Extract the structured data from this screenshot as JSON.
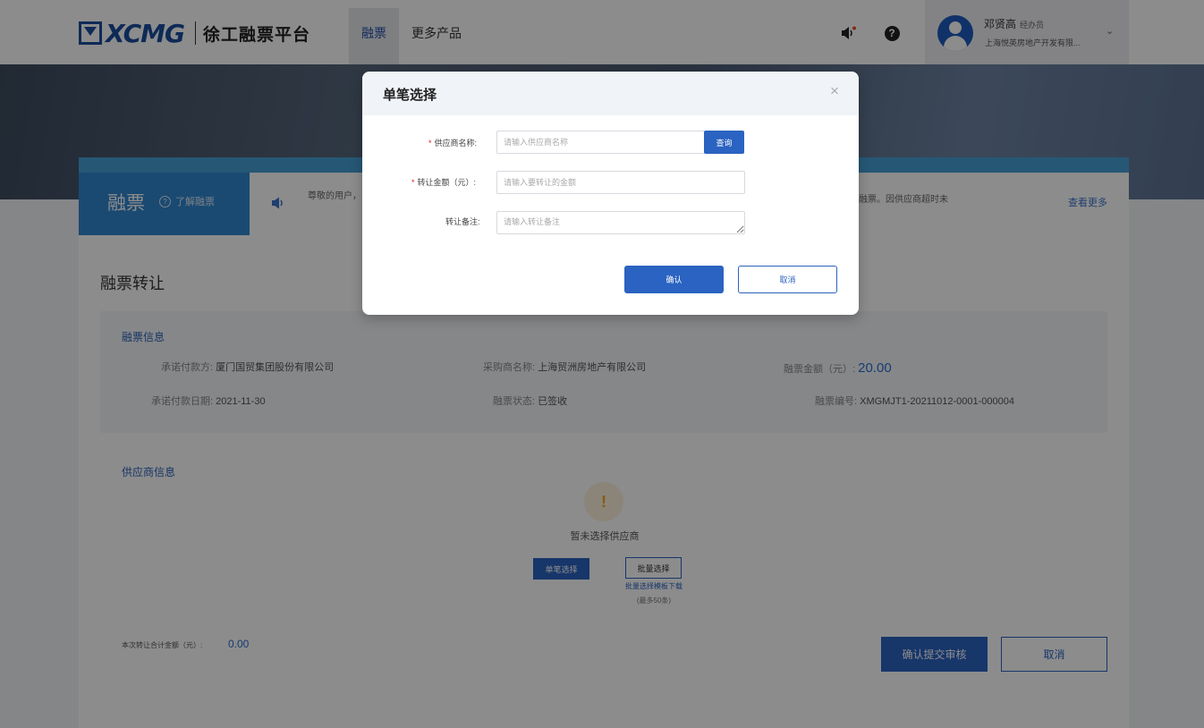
{
  "header": {
    "logo_text": "XCMG",
    "platform_name": "徐工融票平台",
    "nav": [
      {
        "label": "融票",
        "active": true
      },
      {
        "label": "更多产品",
        "active": false
      }
    ],
    "icons": [
      "speaker-icon",
      "help-icon"
    ],
    "user": {
      "name": "邓贤高",
      "role": "经办员",
      "company": "上海悦英房地产开发有限..."
    }
  },
  "promo": {
    "title": "融票",
    "link": "了解融票"
  },
  "notice": {
    "text": "尊敬的用户，签收已自动",
    "tail": "融票。因供应商超时未",
    "more": "查看更多"
  },
  "main": {
    "page_title": "融票转让",
    "info": {
      "section_title": "融票信息",
      "acceptor_label": "承诺付款方:",
      "acceptor_value": "厦门国贸集团股份有限公司",
      "buyer_label": "采购商名称:",
      "buyer_value": "上海贸洲房地产有限公司",
      "amount_label": "融票金额（元）:",
      "amount_value": "20.00",
      "date_label": "承诺付款日期:",
      "date_value": "2021-11-30",
      "status_label": "融票状态:",
      "status_value": "已签收",
      "number_label": "融票编号:",
      "number_value": "XMGMJT1-20211012-0001-000004"
    },
    "supplier": {
      "section_title": "供应商信息",
      "empty_icon": "!",
      "empty_text": "暂未选择供应商",
      "single_button": "单笔选择",
      "batch_button": "批量选择",
      "batch_template": "批量选择模板下载",
      "batch_limit": "(最多50条)"
    },
    "total_label": "本次转让合计金额（元）:",
    "total_value": "0.00",
    "submit_button": "确认提交审核",
    "cancel_button": "取消"
  },
  "modal": {
    "title": "单笔选择",
    "close": "×",
    "supplier_label": "供应商名称:",
    "supplier_placeholder": "请输入供应商名称",
    "query_button": "查询",
    "amount_label": "转让金额（元）:",
    "amount_placeholder": "请输入要转让的金额",
    "remark_label": "转让备注:",
    "remark_placeholder": "请输入转让备注",
    "confirm_button": "确认",
    "cancel_button": "取消"
  },
  "colors": {
    "brand": "#1a4d9e",
    "primary_button": "#2a63c1",
    "promo_bg": "#3188d0",
    "amount_text": "#2a6cd2",
    "required": "#e02020"
  }
}
